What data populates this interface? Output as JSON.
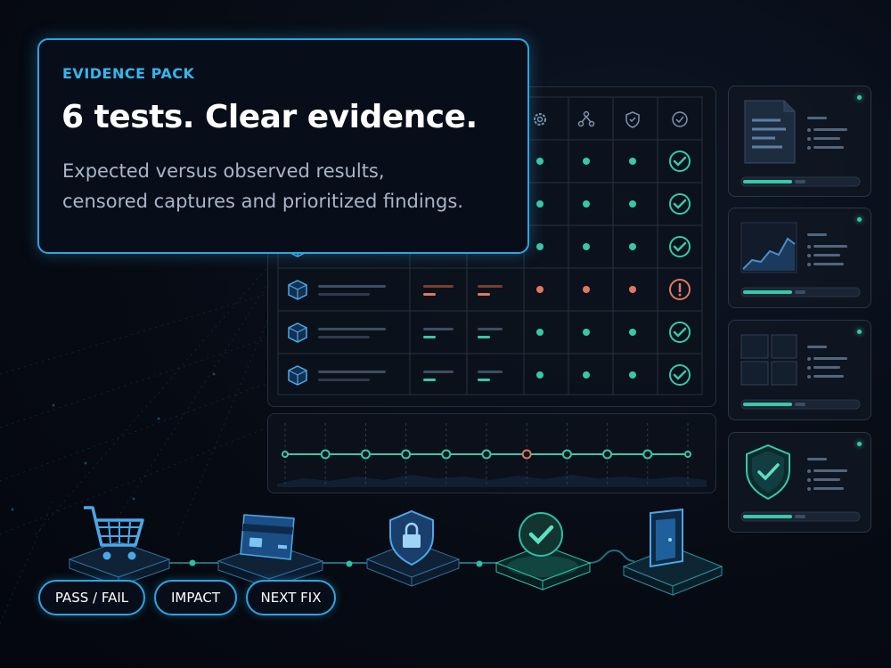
{
  "hero": {
    "eyebrow": "EVIDENCE PACK",
    "headline": "6 tests. Clear evidence.",
    "subline_1": "Expected versus observed results,",
    "subline_2": "censored captures and prioritized findings."
  },
  "pills": [
    {
      "label": "PASS / FAIL"
    },
    {
      "label": "IMPACT"
    },
    {
      "label": "NEXT FIX"
    }
  ],
  "table": {
    "header_icons": [
      "gear-icon",
      "network-icon",
      "shield-check-icon",
      "check-circle-icon"
    ],
    "rows": [
      {
        "status": "pass"
      },
      {
        "status": "pass"
      },
      {
        "status": "pass"
      },
      {
        "status": "fail"
      },
      {
        "status": "pass"
      },
      {
        "status": "pass"
      }
    ]
  },
  "timeline": {
    "nodes": [
      "pass",
      "pass",
      "pass",
      "pass",
      "pass",
      "pass",
      "fail",
      "pass",
      "pass",
      "pass",
      "pass"
    ]
  },
  "cards": [
    {
      "icon": "document-icon"
    },
    {
      "icon": "area-chart-icon"
    },
    {
      "icon": "grid-tiles-icon"
    },
    {
      "icon": "shield-check-icon"
    }
  ],
  "flow_steps": [
    {
      "icon": "shopping-cart-icon"
    },
    {
      "icon": "credit-card-icon"
    },
    {
      "icon": "shield-lock-icon"
    },
    {
      "icon": "check-badge-icon"
    },
    {
      "icon": "exit-door-icon"
    }
  ],
  "colors": {
    "accent": "#2aa6e2",
    "pass": "#36c9a8",
    "fail": "#e0785e",
    "background": "#060a12"
  }
}
